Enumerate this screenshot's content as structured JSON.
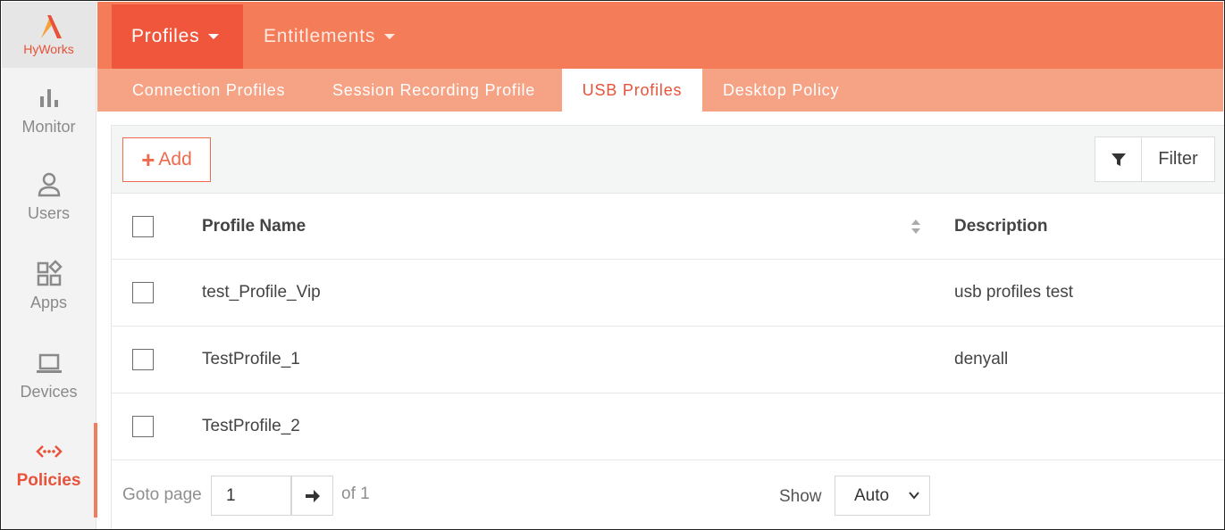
{
  "brand": {
    "name": "HyWorks",
    "color": "#e8523a"
  },
  "sidebar": {
    "items": [
      {
        "label": "Monitor",
        "icon": "bar-chart-icon",
        "active": false
      },
      {
        "label": "Users",
        "icon": "user-icon",
        "active": false
      },
      {
        "label": "Apps",
        "icon": "apps-icon",
        "active": false
      },
      {
        "label": "Devices",
        "icon": "laptop-icon",
        "active": false
      },
      {
        "label": "Policies",
        "icon": "policies-icon",
        "active": true
      }
    ]
  },
  "top_tabs": [
    {
      "label": "Profiles",
      "active": true
    },
    {
      "label": "Entitlements",
      "active": false
    }
  ],
  "sub_tabs": [
    {
      "label": "Connection Profiles",
      "active": false
    },
    {
      "label": "Session Recording Profile",
      "active": false
    },
    {
      "label": "USB Profiles",
      "active": true
    },
    {
      "label": "Desktop Policy",
      "active": false
    }
  ],
  "toolbar": {
    "add_label": "Add",
    "filter_label": "Filter"
  },
  "table": {
    "columns": [
      "Profile Name",
      "Description"
    ],
    "rows": [
      {
        "name": "test_Profile_Vip",
        "description": "usb profiles test"
      },
      {
        "name": "TestProfile_1",
        "description": "denyall"
      },
      {
        "name": "TestProfile_2",
        "description": ""
      }
    ]
  },
  "pager": {
    "goto_label": "Goto page",
    "page_value": "1",
    "of_label": "of 1",
    "show_label": "Show",
    "show_value": "Auto"
  },
  "colors": {
    "topbar": "#f47c59",
    "topbar_active": "#f0563c",
    "subbar": "#f6a385",
    "accent": "#ef6a4c"
  }
}
